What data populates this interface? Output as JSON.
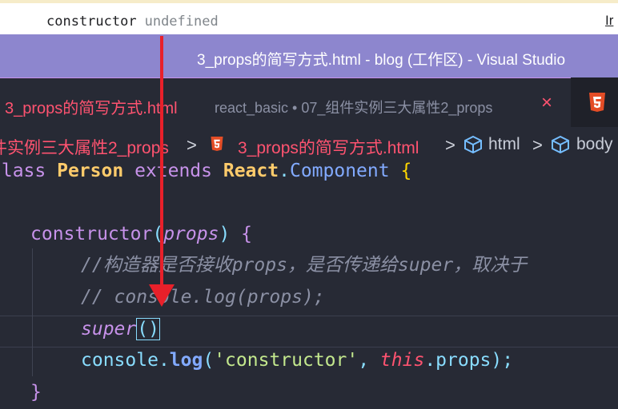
{
  "console": {
    "label": "constructor",
    "value": "undefined",
    "right_text": "Ir"
  },
  "window": {
    "title": "3_props的简写方式.html - blog (工作区) - Visual Studio"
  },
  "tab": {
    "name": "3_props的简写方式.html",
    "path": "react_basic • 07_组件实例三大属性2_props",
    "close": "×"
  },
  "breadcrumb": {
    "folder": "件实例三大属性2_props",
    "sep": ">",
    "file": "3_props的简写方式.html",
    "node1": "html",
    "node2": "body"
  },
  "code": {
    "l1": {
      "a": "class",
      "b": "Person",
      "c": "extends",
      "d": "React",
      "e": ".",
      "f": "Component",
      "g": "{"
    },
    "l2": {
      "a": "constructor",
      "b": "(",
      "c": "props",
      "d": ")",
      "e": "{"
    },
    "l3": "//构造器是否接收props，是否传递给super，取决于",
    "l4": "// console.log(props);",
    "l5": {
      "a": "super",
      "b": "()"
    },
    "l6": {
      "a": "console",
      "b": ".",
      "c": "log",
      "d": "(",
      "e": "'constructor'",
      "f": ", ",
      "g": "this",
      "h": ".props",
      "i": ");"
    },
    "l7": "}"
  },
  "colors": {
    "title_bar": "#8d86ce",
    "annotation_arrow": "#e8202a",
    "editor_bg": "#272a35"
  },
  "icons": [
    "html5-file-icon",
    "symbol-element-icon",
    "close-icon",
    "chevron-right-icon"
  ]
}
